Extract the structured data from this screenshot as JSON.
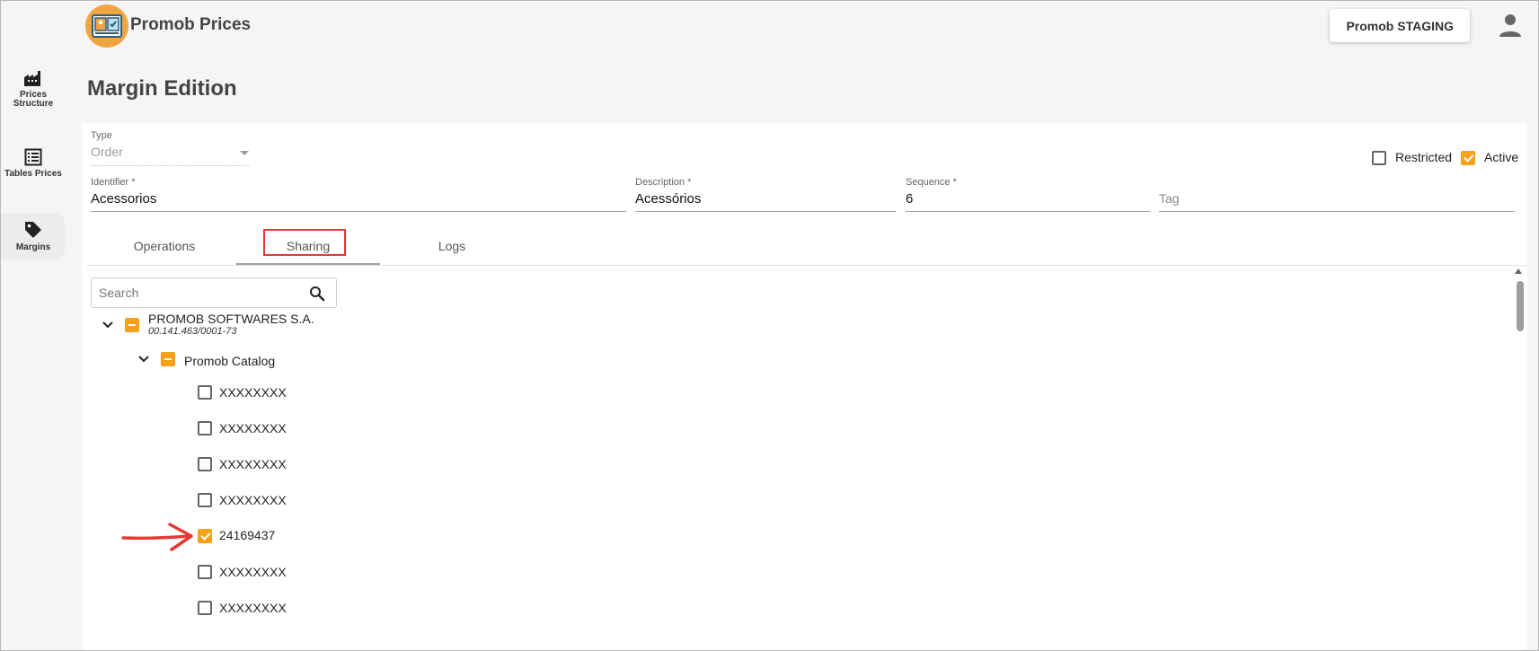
{
  "app": {
    "title": "Promob Prices",
    "environment_button": "Promob STAGING"
  },
  "sidebar": {
    "items": [
      {
        "label_line1": "Prices",
        "label_line2": "Structure",
        "icon": "factory-icon"
      },
      {
        "label_line1": "Tables Prices",
        "icon": "table-list-icon"
      },
      {
        "label_line1": "Margins",
        "icon": "tag-icon",
        "active": true
      }
    ]
  },
  "page": {
    "title": "Margin Edition"
  },
  "form": {
    "type": {
      "label": "Type",
      "value": "Order"
    },
    "restricted": {
      "label": "Restricted",
      "checked": false
    },
    "active": {
      "label": "Active",
      "checked": true
    },
    "identifier": {
      "label": "Identifier *",
      "value": "Acessorios"
    },
    "description": {
      "label": "Description *",
      "value": "Acessórios"
    },
    "sequence": {
      "label": "Sequence *",
      "value": "6"
    },
    "tag": {
      "placeholder": "Tag"
    }
  },
  "tabs": [
    {
      "label": "Operations"
    },
    {
      "label": "Sharing",
      "active": true
    },
    {
      "label": "Logs"
    }
  ],
  "sharing": {
    "search_placeholder": "Search",
    "company": {
      "name": "PROMOB SOFTWARES S.A.",
      "document": "00.141.463/0001-73",
      "state": "indeterminate"
    },
    "catalog": {
      "name": "Promob Catalog",
      "state": "indeterminate"
    },
    "items": [
      {
        "label": "XXXXXXXX",
        "checked": false
      },
      {
        "label": "XXXXXXXX",
        "checked": false
      },
      {
        "label": "XXXXXXXX",
        "checked": false
      },
      {
        "label": "XXXXXXXX",
        "checked": false
      },
      {
        "label": "24169437",
        "checked": true
      },
      {
        "label": "XXXXXXXX",
        "checked": false
      },
      {
        "label": "XXXXXXXX",
        "checked": false
      }
    ]
  },
  "colors": {
    "accent": "#f7a11a",
    "annotation": "#e53935",
    "logo": "#f0a543"
  }
}
